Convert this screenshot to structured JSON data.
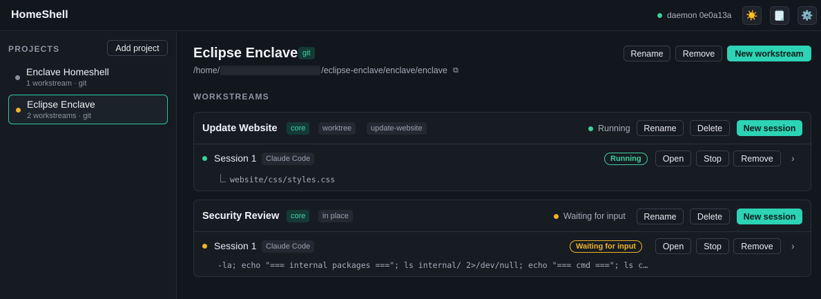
{
  "header": {
    "app_title": "HomeShell",
    "daemon_label": "daemon 0e0a13a",
    "theme_icon": "☀️",
    "notes_icon": "🗒️",
    "settings_icon": "⚙️"
  },
  "sidebar": {
    "heading": "PROJECTS",
    "add_label": "Add project",
    "projects": [
      {
        "name": "Enclave Homeshell",
        "sub": "1 workstream · git"
      },
      {
        "name": "Eclipse Enclave",
        "sub": "2 workstreams · git"
      }
    ]
  },
  "project": {
    "title": "Eclipse Enclave",
    "vcs_tag": "git",
    "path_prefix": "/home/",
    "path_suffix": "/eclipse-enclave/enclave/enclave",
    "copy_icon": "⧉",
    "rename_label": "Rename",
    "remove_label": "Remove",
    "new_workstream_label": "New workstream"
  },
  "workstreams_heading": "WORKSTREAMS",
  "workstreams": [
    {
      "title": "Update Website",
      "tags": [
        "core",
        "worktree",
        "update-website"
      ],
      "status": "Running",
      "rename": "Rename",
      "delete": "Delete",
      "new_session": "New session",
      "session": {
        "name": "Session 1",
        "agent": "Claude Code",
        "pill": "Running",
        "open": "Open",
        "stop": "Stop",
        "remove": "Remove",
        "chevron": "›",
        "detail": "website/css/styles.css"
      }
    },
    {
      "title": "Security Review",
      "tags": [
        "core",
        "in place"
      ],
      "status": "Waiting for input",
      "rename": "Rename",
      "delete": "Delete",
      "new_session": "New session",
      "session": {
        "name": "Session 1",
        "agent": "Claude Code",
        "pill": "Waiting for input",
        "open": "Open",
        "stop": "Stop",
        "remove": "Remove",
        "chevron": "›",
        "detail": "-la; echo \"=== internal packages ===\"; ls internal/ 2>/dev/null; echo \"=== cmd ===\"; ls c…"
      }
    }
  ],
  "colors": {
    "accent": "#2cd3b5",
    "running": "#3ecf9a",
    "waiting": "#f0b429"
  }
}
